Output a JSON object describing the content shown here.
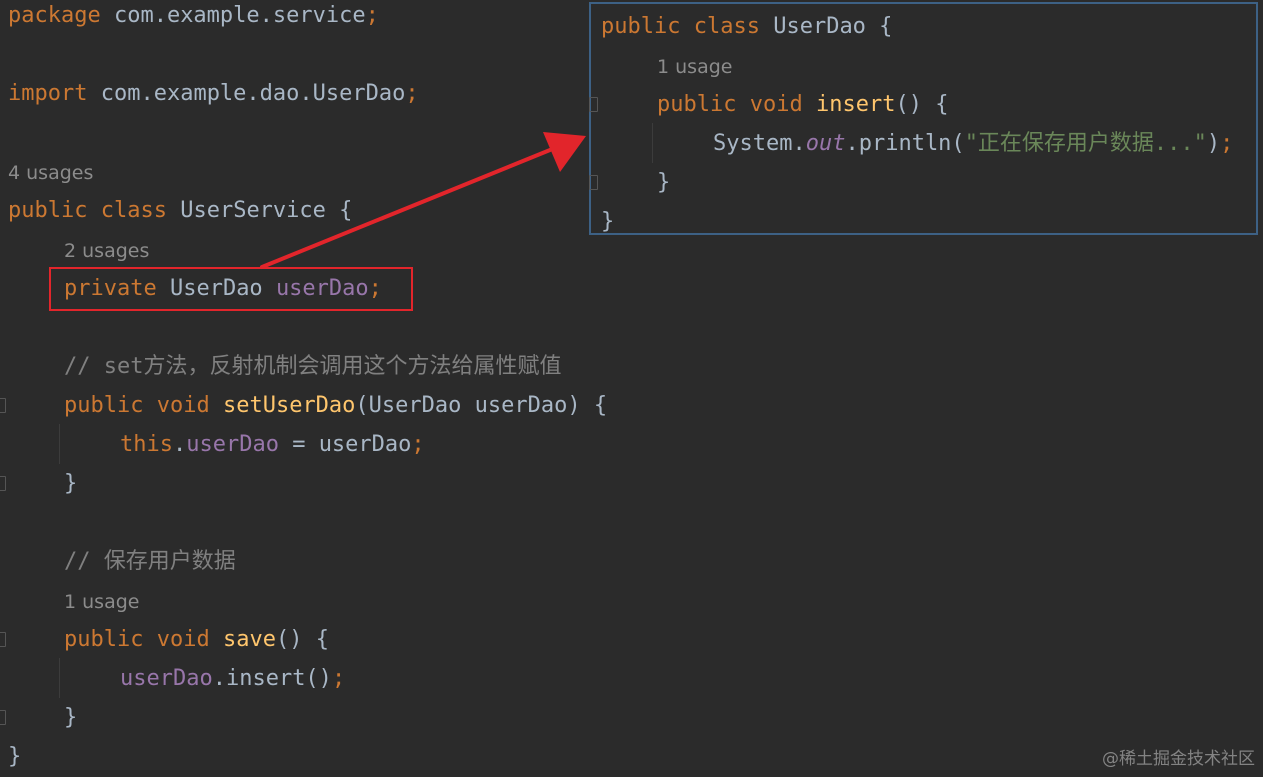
{
  "main_code": {
    "package_kw": "package",
    "package_name": " com.example.service",
    "semicolon": ";",
    "import_kw": "import",
    "import_name": " com.example.dao.UserDao",
    "class_usages": "4 usages",
    "public_kw": "public",
    "class_kw": "class",
    "class_name": " UserService {",
    "field_usages": "2 usages",
    "private_kw": "private",
    "field_type": " UserDao ",
    "field_name": "userDao",
    "comment_set": "// set方法，反射机制会调用这个方法给属性赋值",
    "void_kw": "void",
    "setter_name": "setUserDao",
    "setter_params": "(UserDao userDao) {",
    "this_kw": "this",
    "dot": ".",
    "assign_rest": " = userDao",
    "close_brace": "}",
    "comment_save": "// 保存用户数据",
    "save_usages": "1 usage",
    "save_name": "save",
    "save_params": "() {",
    "call_target": "userDao",
    "call_rest": ".insert()"
  },
  "popup_code": {
    "public_kw": "public",
    "class_kw": "class",
    "class_name": " UserDao {",
    "method_usages": "1 usage",
    "void_kw": "void",
    "method_name": "insert",
    "method_params": "() {",
    "system": "System.",
    "out": "out",
    "println": ".println(",
    "string": "\"正在保存用户数据...\"",
    "close_paren": ")",
    "semicolon": ";",
    "close_brace": "}"
  },
  "annotations": {
    "highlight_color": "#e2252b",
    "arrow_color": "#e2252b"
  },
  "watermark": "@稀土掘金技术社区",
  "colors": {
    "background": "#2b2b2b",
    "keyword": "#cc7832",
    "function": "#ffc66d",
    "field": "#9876aa",
    "string": "#6a8759",
    "comment": "#808080",
    "text": "#a9b7c6",
    "popup_border": "#3d6185"
  }
}
